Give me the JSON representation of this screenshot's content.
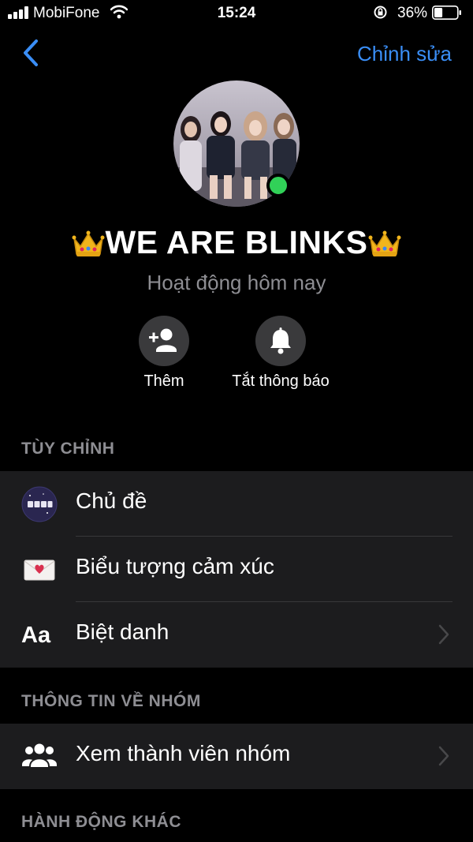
{
  "status_bar": {
    "carrier": "MobiFone",
    "time": "15:24",
    "battery_percent": "36%",
    "battery_level": 0.36
  },
  "nav": {
    "edit_label": "Chỉnh sửa"
  },
  "profile": {
    "name": "WE ARE BLINKS",
    "activity": "Hoạt động hôm nay",
    "online": true
  },
  "actions": [
    {
      "label": "Thêm",
      "icon": "add-person-icon"
    },
    {
      "label": "Tắt thông báo",
      "icon": "bell-icon"
    }
  ],
  "sections": {
    "customize": {
      "title": "TÙY CHỈNH",
      "items": [
        {
          "label": "Chủ đề",
          "icon": "theme-icon"
        },
        {
          "label": "Biểu tượng cảm xúc",
          "icon": "heart-letter-emoji-icon"
        },
        {
          "label": "Biệt danh",
          "icon": "aa-icon",
          "icon_text": "Aa"
        }
      ]
    },
    "group_info": {
      "title": "THÔNG TIN VỀ NHÓM",
      "items": [
        {
          "label": "Xem thành viên nhóm",
          "icon": "group-members-icon"
        }
      ]
    },
    "other_actions": {
      "title": "HÀNH ĐỘNG KHÁC"
    }
  },
  "colors": {
    "accent": "#3a8ef6",
    "online": "#31d158",
    "row_bg": "#1c1c1e",
    "secondary_text": "#8e8e93"
  }
}
